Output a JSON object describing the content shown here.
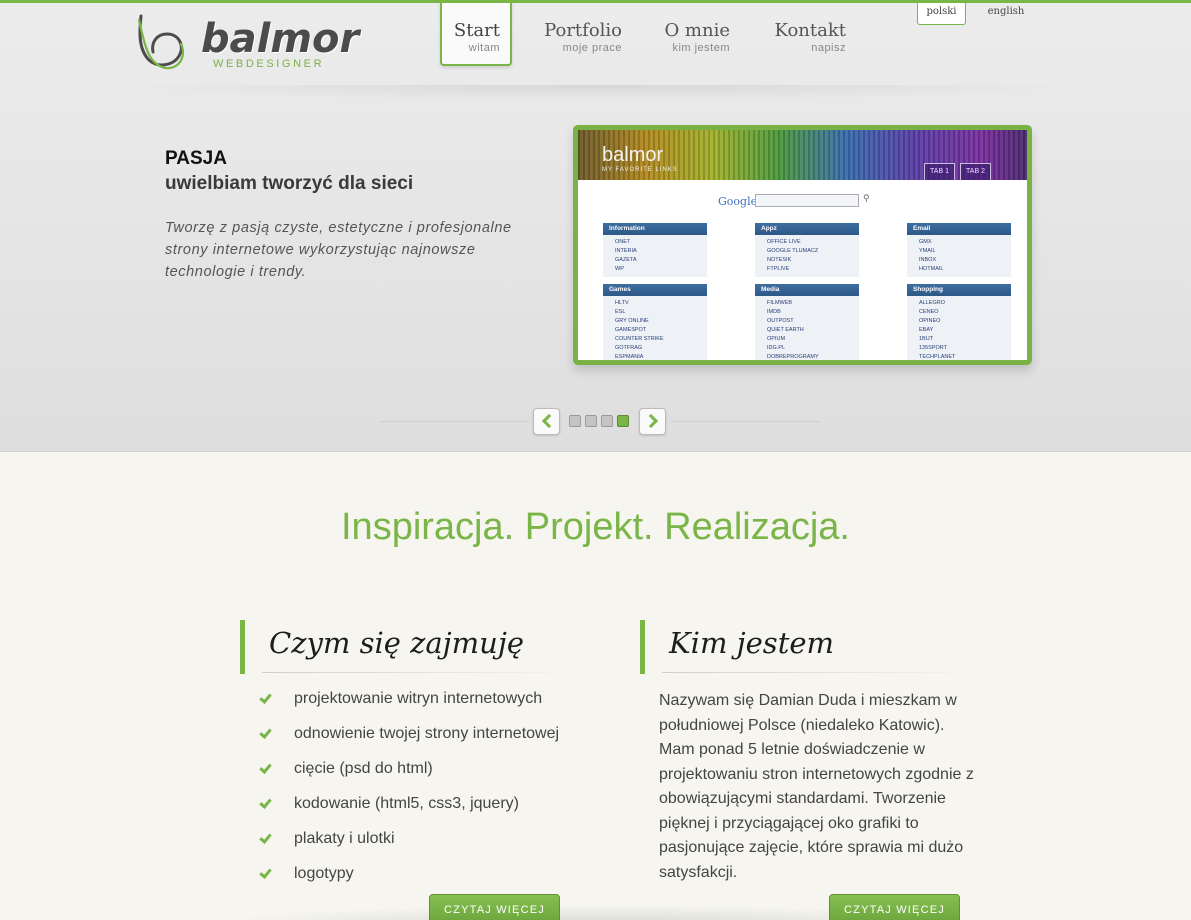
{
  "brand": {
    "name": "balmor",
    "tagline": "WEBDESIGNER",
    "accent": "#7ab547"
  },
  "nav": [
    {
      "title": "Start",
      "subtitle": "witam",
      "active": true
    },
    {
      "title": "Portfolio",
      "subtitle": "moje prace",
      "active": false
    },
    {
      "title": "O mnie",
      "subtitle": "kim jestem",
      "active": false
    },
    {
      "title": "Kontakt",
      "subtitle": "napisz",
      "active": false
    }
  ],
  "languages": [
    {
      "label": "polski",
      "active": true
    },
    {
      "label": "english",
      "active": false
    }
  ],
  "slider": {
    "heading": "PASJA",
    "subheading": "uwielbiam tworzyć dla sieci",
    "text": "Tworzę z pasją czyste, estetyczne i profesjonalne strony internetowe wykorzystując najnowsze technologie i trendy.",
    "slide_count": 4,
    "active_slide": 4,
    "preview": {
      "title": "balmor",
      "subtitle": "MY FAVORITE LINKS",
      "tabs": [
        "TAB 1",
        "TAB 2"
      ],
      "search_brand": "Google",
      "boxes": [
        {
          "title": "Information",
          "links": [
            "ONET",
            "INTERIA",
            "GAZETA",
            "WP"
          ]
        },
        {
          "title": "Appz",
          "links": [
            "OFFICE LIVE",
            "GOOGLE TLUMACZ",
            "NOTESIK",
            "FTPLIVE"
          ]
        },
        {
          "title": "Email",
          "links": [
            "GMX",
            "YMAIL",
            "INBOX",
            "HOTMAIL"
          ]
        },
        {
          "title": "Games",
          "links": [
            "HLTV",
            "ESL",
            "GRY ONLINE",
            "GAMESPOT",
            "COUNTER STRIKE",
            "GOTFRAG",
            "ESPMANIA"
          ]
        },
        {
          "title": "Media",
          "links": [
            "FILMWEB",
            "IMDB",
            "OUTPOST",
            "QUIET EARTH",
            "OPIUM",
            "IDG.PL",
            "DOBREPROGRAMY"
          ]
        },
        {
          "title": "Shopping",
          "links": [
            "ALLEGRO",
            "CENEO",
            "OPINEO",
            "EBAY",
            "1BUT",
            "135SPORT",
            "TECHPLANET"
          ]
        }
      ]
    }
  },
  "main": {
    "tagline": "Inspiracja. Projekt. Realizacja.",
    "services": {
      "title": "Czym się zajmuję",
      "items": [
        "projektowanie witryn internetowych",
        "odnowienie twojej strony internetowej",
        "cięcie (psd do html)",
        "kodowanie (html5, css3, jquery)",
        "plakaty i ulotki",
        "logotypy"
      ],
      "button": "CZYTAJ WIĘCEJ"
    },
    "about": {
      "title": "Kim jestem",
      "text": "Nazywam się Damian Duda i mieszkam w południowej Polsce (niedaleko Katowic). Mam ponad 5 letnie doświadczenie w projektowaniu stron internetowych zgodnie z obowiązującymi standardami. Tworzenie pięknej i przyciągającej oko grafiki to pasjonujące zajęcie, które sprawia mi dużo satysfakcji.",
      "button": "CZYTAJ WIĘCEJ"
    }
  }
}
